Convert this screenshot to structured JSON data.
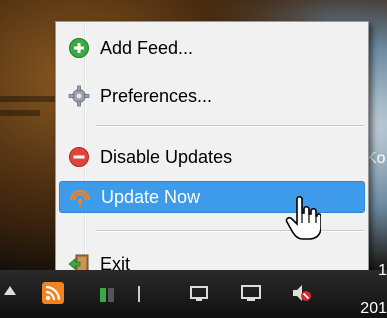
{
  "menu": {
    "items": [
      {
        "label": "Add Feed...",
        "icon": "plus-circle-icon"
      },
      {
        "label": "Preferences...",
        "icon": "gear-icon"
      },
      {
        "label": "Disable Updates",
        "icon": "minus-circle-icon"
      },
      {
        "label": "Update Now",
        "icon": "rss-icon",
        "highlighted": true
      },
      {
        "label": "Exit",
        "icon": "exit-door-icon"
      }
    ]
  },
  "desktop": {
    "partial_label": "Ko"
  },
  "clock": {
    "top_partial": "1",
    "bottom_partial": "201"
  },
  "colors": {
    "highlight": "#3d9be9",
    "menu_bg": "#f1f1f1",
    "rss_orange": "#f58220"
  }
}
